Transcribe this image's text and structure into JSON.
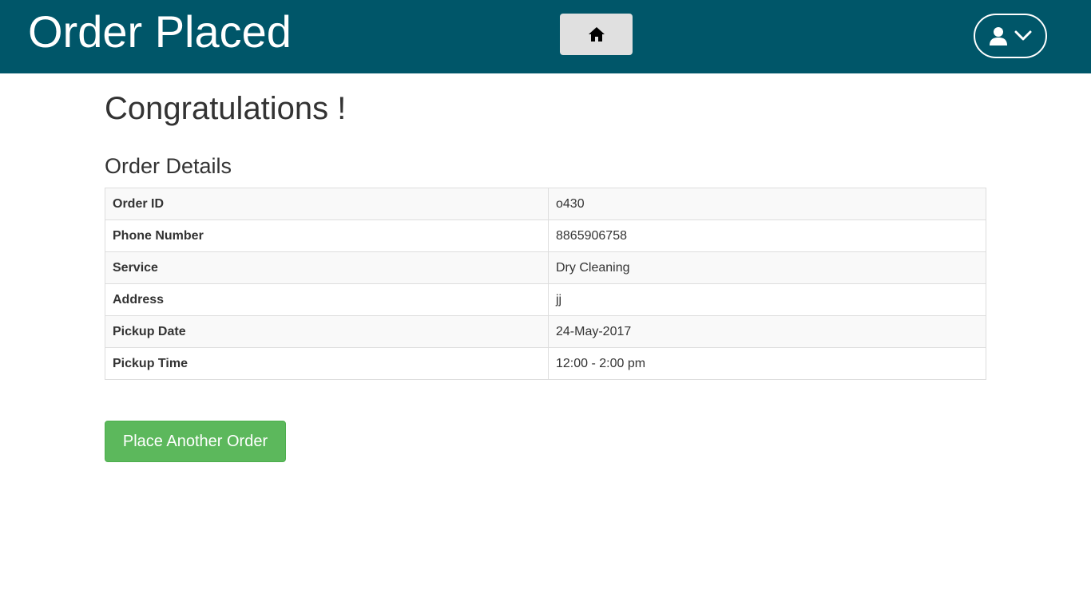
{
  "header": {
    "title": "Order Placed",
    "background_color": "#005669",
    "home_icon": "home-icon",
    "user_icon": "user-icon",
    "dropdown_icon": "chevron-down-icon"
  },
  "main": {
    "heading": "Congratulations !",
    "section_title": "Order Details",
    "details": [
      {
        "label": "Order ID",
        "value": "o430"
      },
      {
        "label": "Phone Number",
        "value": "8865906758"
      },
      {
        "label": "Service",
        "value": "Dry Cleaning"
      },
      {
        "label": "Address",
        "value": "jj"
      },
      {
        "label": "Pickup Date",
        "value": "24-May-2017"
      },
      {
        "label": "Pickup Time",
        "value": "12:00 - 2:00 pm"
      }
    ],
    "place_another_label": "Place Another Order",
    "button_color": "#5cb85c"
  }
}
